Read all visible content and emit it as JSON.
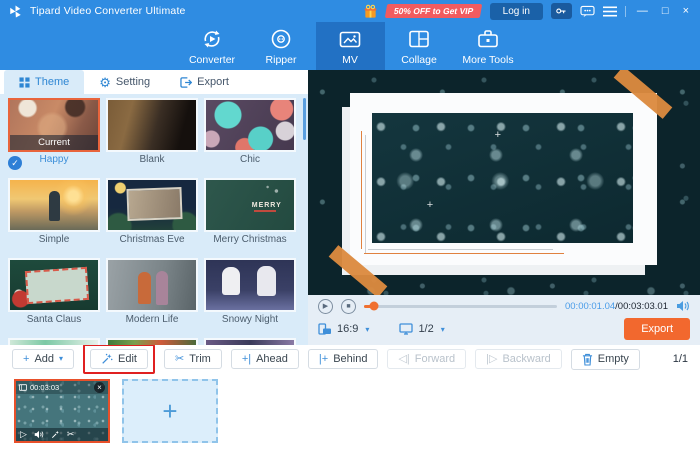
{
  "titlebar": {
    "app_title": "Tipard Video Converter Ultimate",
    "promo_badge": "50% OFF to Get VIP",
    "login_label": "Log in"
  },
  "nav": {
    "converter": "Converter",
    "ripper": "Ripper",
    "mv": "MV",
    "collage": "Collage",
    "more_tools": "More Tools"
  },
  "left_panel": {
    "tab_theme": "Theme",
    "tab_setting": "Setting",
    "tab_export": "Export",
    "current_badge": "Current",
    "themes": [
      {
        "name": "Happy",
        "selected": true
      },
      {
        "name": "Blank"
      },
      {
        "name": "Chic"
      },
      {
        "name": "Simple"
      },
      {
        "name": "Christmas Eve"
      },
      {
        "name": "Merry Christmas"
      },
      {
        "name": "Santa Claus"
      },
      {
        "name": "Modern Life"
      },
      {
        "name": "Snowy Night"
      }
    ],
    "merry_text": "MERRY"
  },
  "preview": {
    "time_current": "00:00:01.04",
    "time_total": "/00:03:03.01",
    "aspect_ratio": "16:9",
    "display_scale": "1/2",
    "export_label": "Export"
  },
  "toolbar": {
    "add": "Add",
    "edit": "Edit",
    "trim": "Trim",
    "ahead": "Ahead",
    "behind": "Behind",
    "forward": "Forward",
    "backward": "Backward",
    "empty": "Empty",
    "page_indicator": "1/1"
  },
  "timeline": {
    "clip_duration": "00:03:03"
  },
  "icons": {
    "dropdown": "▾",
    "plus": "+",
    "scissors": "✂",
    "gear": "⚙",
    "check": "✓",
    "close": "×",
    "minimize": "—",
    "maximize": "□",
    "play": "▶",
    "stop": "■",
    "play_outline": "▷",
    "ahead_icon": "+|",
    "behind_icon": "|+",
    "forward_icon": "◁|",
    "backward_icon": "|▷",
    "crosshair": "+"
  },
  "colors": {
    "accent_blue": "#2f8ce2",
    "nav_active_blue": "#2271c4",
    "accent_orange": "#f2682e",
    "promo_red": "#f25b5f",
    "highlight_red": "#e02020",
    "panel_light_blue": "#d9ebf9"
  }
}
